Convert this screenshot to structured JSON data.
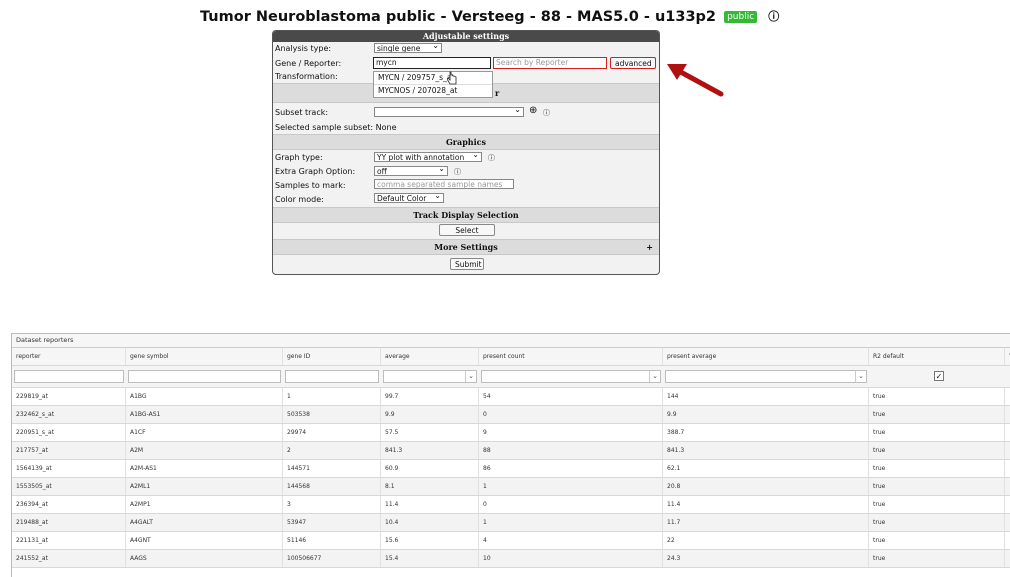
{
  "page": {
    "title": "Tumor Neuroblastoma public - Versteeg - 88 - MAS5.0 - u133p2",
    "badge": "public",
    "info_icon": "info-icon"
  },
  "settings": {
    "header": "Adjustable settings",
    "analysis_type_label": "Analysis type:",
    "analysis_type_value": "single gene",
    "gene_label": "Gene / Reporter:",
    "gene_value": "mycn",
    "search_placeholder": "Search by Reporter",
    "advanced_label": "advanced",
    "transformation_label": "Transformation:",
    "suggestions": [
      "MYCN / 209757_s_at",
      "MYCNOS / 207028_at"
    ],
    "obscured_char": "r",
    "subset_label": "Subset track:",
    "subset_value": "",
    "selected_subset_label": "Selected sample subset:",
    "selected_subset_value": "None",
    "graphics_header": "Graphics",
    "graph_type_label": "Graph type:",
    "graph_type_value": "YY plot with annotation",
    "extra_label": "Extra Graph Option:",
    "extra_value": "off",
    "samples_label": "Samples to mark:",
    "samples_placeholder": "comma separated sample names",
    "color_label": "Color mode:",
    "color_value": "Default Color",
    "track_header": "Track Display Selection",
    "select_tracks_label": "Select tracks",
    "more_header": "More Settings",
    "more_plus": "+",
    "submit_label": "Submit"
  },
  "table": {
    "caption": "Dataset reporters",
    "columns": [
      "reporter",
      "gene symbol",
      "gene ID",
      "average",
      "present count",
      "present average",
      "R2 default",
      "Y"
    ],
    "rows": [
      [
        "229819_at",
        "A1BG",
        "1",
        "99.7",
        "54",
        "144",
        "true"
      ],
      [
        "232462_s_at",
        "A1BG-AS1",
        "503538",
        "9.9",
        "0",
        "9.9",
        "true"
      ],
      [
        "220951_s_at",
        "A1CF",
        "29974",
        "57.5",
        "9",
        "388.7",
        "true"
      ],
      [
        "217757_at",
        "A2M",
        "2",
        "841.3",
        "88",
        "841.3",
        "true"
      ],
      [
        "1564139_at",
        "A2M-AS1",
        "144571",
        "60.9",
        "86",
        "62.1",
        "true"
      ],
      [
        "1553505_at",
        "A2ML1",
        "144568",
        "8.1",
        "1",
        "20.8",
        "true"
      ],
      [
        "236394_at",
        "A2MP1",
        "3",
        "11.4",
        "0",
        "11.4",
        "true"
      ],
      [
        "219488_at",
        "A4GALT",
        "53947",
        "10.4",
        "1",
        "11.7",
        "true"
      ],
      [
        "221131_at",
        "A4GNT",
        "51146",
        "15.6",
        "4",
        "22",
        "true"
      ],
      [
        "241552_at",
        "AAGS",
        "100506677",
        "15.4",
        "10",
        "24.3",
        "true"
      ]
    ]
  },
  "colors": {
    "panel_header": "#4a4a4a",
    "badge": "#35b835",
    "arrow": "#b01010",
    "highlight_border": "#d11f1f"
  }
}
